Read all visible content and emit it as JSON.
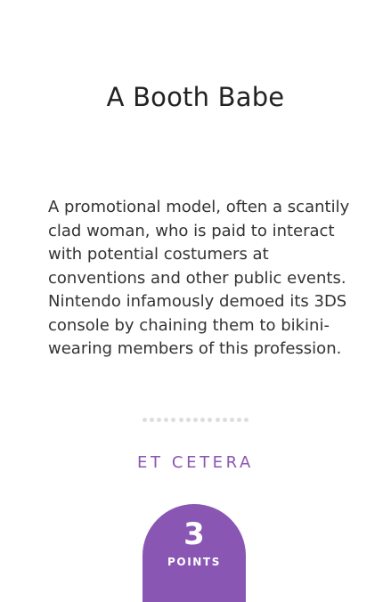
{
  "card": {
    "title": "A Booth Babe",
    "definition": "A promotional model, often a scantily clad woman, who is paid to interact with potential costumers at conventions and other public events. Nintendo infamously demoed its 3DS console by chaining them to bikini-wearing members of this profession.",
    "category": "ET CETERA",
    "points": {
      "value": "3",
      "label": "POINTS"
    }
  },
  "colors": {
    "accent": "#8a56b4",
    "divider_dots": "#dddddd"
  }
}
